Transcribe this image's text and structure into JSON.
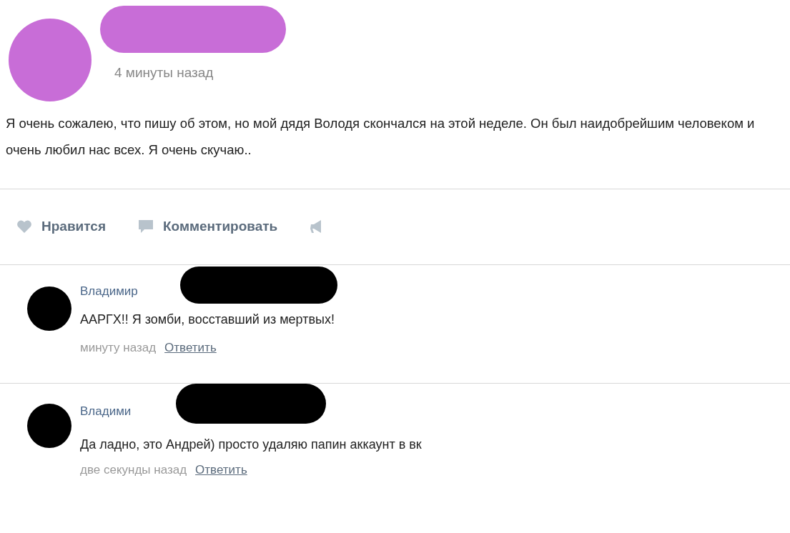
{
  "post": {
    "time": "4 минуты назад",
    "text": "Я очень сожалею, что пишу об этом, но мой дядя Володя скончался на этой неделе. Он был наидобрейшим человеком и очень любил нас всех. Я очень скучаю..",
    "actions": [
      {
        "kind": "like",
        "label": "Нравится"
      },
      {
        "kind": "comment",
        "label": "Комментировать"
      },
      {
        "kind": "share"
      }
    ]
  },
  "comments": [
    {
      "author": "Владимир",
      "text": "ААРГХ!! Я зомби, восставший из мертвых!",
      "time": "минуту назад",
      "reply": "Ответить"
    },
    {
      "author": "Владими",
      "text": "Да ладно, это Андрей) просто удаляю папин аккаунт в вк",
      "time": "две секунды назад",
      "reply": "Ответить"
    }
  ]
}
